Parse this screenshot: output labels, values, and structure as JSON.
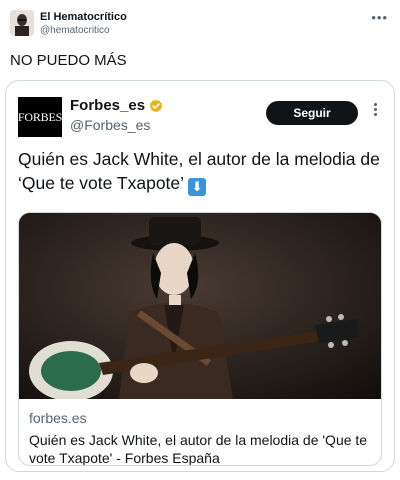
{
  "outer_tweet": {
    "author_name": "El Hematocrítico",
    "author_handle": "@hematocritico",
    "more_icon": "more-horizontal-icon",
    "text": "NO PUEDO MÁS"
  },
  "quoted_tweet": {
    "logo_text": "FORBES",
    "author_name": "Forbes_es",
    "author_handle": "@Forbes_es",
    "verified_color": "#e2b719",
    "follow_label": "Seguir",
    "text": "Quién es Jack White, el autor de la melodia de ‘Que te vote Txapote’",
    "emoji": "⬇"
  },
  "link_card": {
    "image_icon": "photo-guitarist",
    "domain": "forbes.es",
    "title": "Quién es Jack White, el autor de la melodia de 'Que te vote Txapote' - Forbes España"
  },
  "colors": {
    "text_primary": "#0f1419",
    "text_secondary": "#536471",
    "border": "#cfd9de",
    "button_bg": "#0f1419"
  }
}
